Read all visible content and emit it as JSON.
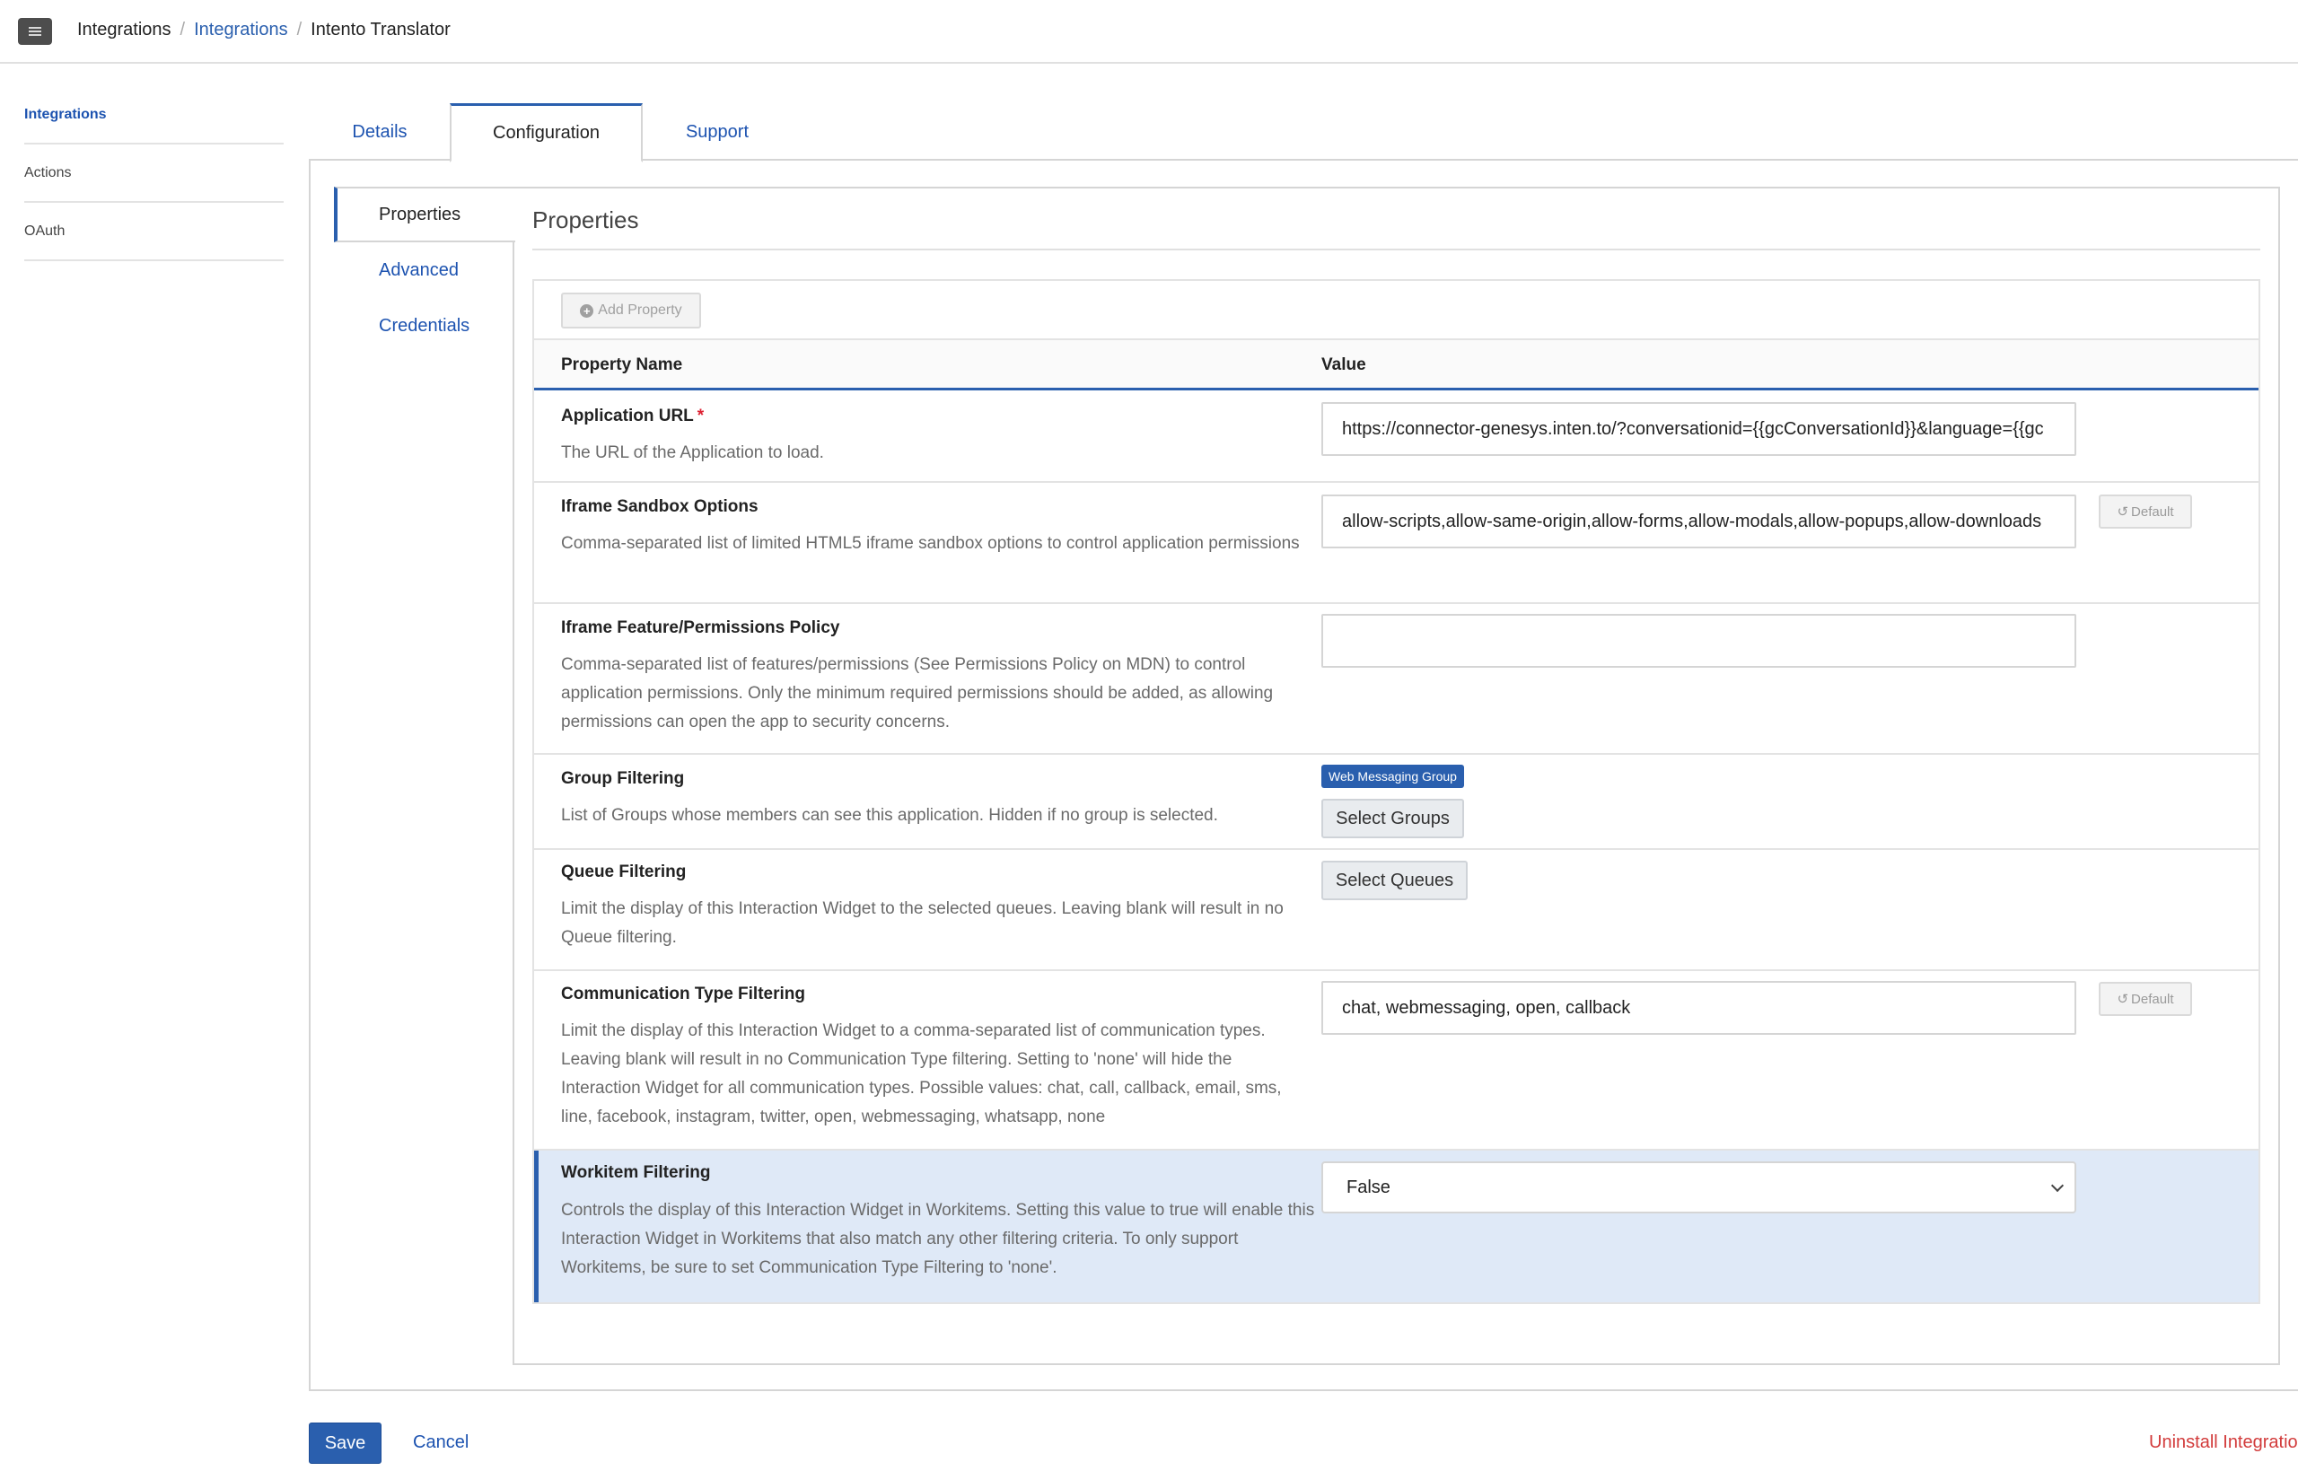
{
  "breadcrumb": {
    "root": "Integrations",
    "parent": "Integrations",
    "current": "Intento Translator",
    "separator": "/"
  },
  "sidebar": {
    "items": [
      {
        "label": "Integrations",
        "active": true
      },
      {
        "label": "Actions",
        "active": false
      },
      {
        "label": "OAuth",
        "active": false
      }
    ]
  },
  "tabs": [
    {
      "label": "Details"
    },
    {
      "label": "Configuration",
      "active": true
    },
    {
      "label": "Support"
    }
  ],
  "subnav": [
    {
      "label": "Properties",
      "active": true
    },
    {
      "label": "Advanced"
    },
    {
      "label": "Credentials"
    }
  ],
  "section": {
    "title": "Properties"
  },
  "toolbar": {
    "add_property_label": "Add Property",
    "add_icon": "plus-circle-icon"
  },
  "table": {
    "header_name": "Property Name",
    "header_value": "Value"
  },
  "properties": {
    "app_url": {
      "name": "Application URL",
      "required_mark": "*",
      "description": "The URL of the Application to load.",
      "value": "https://connector-genesys.inten.to/?conversationid={{gcConversationId}}&language={{gc"
    },
    "sandbox": {
      "name": "Iframe Sandbox Options",
      "description": "Comma-separated list of limited HTML5 iframe sandbox options to control application permissions",
      "value": "allow-scripts,allow-same-origin,allow-forms,allow-modals,allow-popups,allow-downloads",
      "default_label": "Default"
    },
    "feature_policy": {
      "name": "Iframe Feature/Permissions Policy",
      "description": "Comma-separated list of features/permissions (See Permissions Policy on MDN) to control application permissions. Only the minimum required permissions should be added, as allowing permissions can open the app to security concerns.",
      "value": ""
    },
    "group_filtering": {
      "name": "Group Filtering",
      "description": "List of Groups whose members can see this application. Hidden if no group is selected.",
      "tag": "Web Messaging Group",
      "button_label": "Select Groups"
    },
    "queue_filtering": {
      "name": "Queue Filtering",
      "description": "Limit the display of this Interaction Widget to the selected queues. Leaving blank will result in no Queue filtering.",
      "button_label": "Select Queues"
    },
    "comm_type": {
      "name": "Communication Type Filtering",
      "description": "Limit the display of this Interaction Widget to a comma-separated list of communication types. Leaving blank will result in no Communication Type filtering. Setting to 'none' will hide the Interaction Widget for all communication types. Possible values: chat, call, callback, email, sms, line, facebook, instagram, twitter, open, webmessaging, whatsapp, none",
      "value": "chat, webmessaging, open, callback",
      "default_label": "Default"
    },
    "workitem": {
      "name": "Workitem Filtering",
      "description": "Controls the display of this Interaction Widget in Workitems. Setting this value to true will enable this Interaction Widget in Workitems that also match any other filtering criteria. To only support Workitems, be sure to set Communication Type Filtering to 'none'.",
      "selected": "False"
    }
  },
  "footer": {
    "save_label": "Save",
    "cancel_label": "Cancel",
    "uninstall_label": "Uninstall Integration"
  },
  "colors": {
    "accent": "#2a5fae",
    "danger": "#d23b3b",
    "highlight_row": "#dfe9f7"
  }
}
